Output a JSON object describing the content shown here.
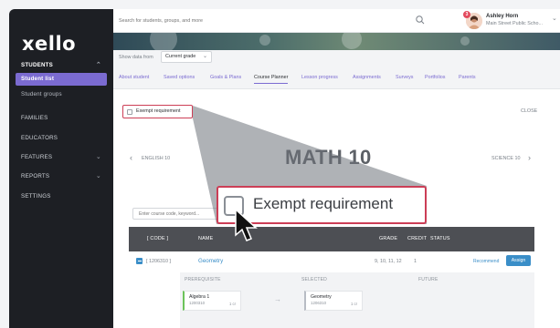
{
  "sidebar": {
    "logo": "xello",
    "items": [
      {
        "label": "STUDENTS"
      },
      {
        "label": "Student list"
      },
      {
        "label": "Student groups"
      },
      {
        "label": "FAMILIES"
      },
      {
        "label": "EDUCATORS"
      },
      {
        "label": "FEATURES"
      },
      {
        "label": "REPORTS"
      },
      {
        "label": "SETTINGS"
      }
    ]
  },
  "topbar": {
    "search_placeholder": "Search for students, groups, and more",
    "user_name": "Ashley Horn",
    "user_school": "Main Street Public Scho...",
    "notification_count": "3"
  },
  "filter": {
    "label": "Show data from",
    "value": "Current grade"
  },
  "tabs": [
    {
      "label": "About student"
    },
    {
      "label": "Saved options"
    },
    {
      "label": "Goals & Plans"
    },
    {
      "label": "Course Planner"
    },
    {
      "label": "Lesson progress"
    },
    {
      "label": "Assignments"
    },
    {
      "label": "Surveys"
    },
    {
      "label": "Portfolios"
    },
    {
      "label": "Parents"
    }
  ],
  "active_tab": "Course Planner",
  "planner": {
    "exempt_label": "Exempt requirement",
    "close_label": "CLOSE",
    "prev_course": "ENGLISH 10",
    "title": "MATH 10",
    "next_course": "SCIENCE 10",
    "code_placeholder": "Enter course code, keyword...",
    "table": {
      "headers": {
        "code": "[ CODE ]",
        "name": "NAME",
        "grade": "GRADE",
        "credit": "CREDIT",
        "status": "STATUS"
      },
      "row": {
        "code": "[ 1206310 ]",
        "name": "Geometry",
        "grade": "9, 10, 11, 12",
        "credit": "1",
        "recommend": "Recommend",
        "assign": "Assign"
      }
    },
    "prereq": {
      "headers": {
        "prerequisite": "PREREQUISITE",
        "selected": "SELECTED",
        "future": "FUTURE"
      },
      "prerequisite_card": {
        "name": "Algebra 1",
        "code": "1200310",
        "credit": "1 cr"
      },
      "selected_card": {
        "name": "Geometry",
        "code": "1206310",
        "credit": "1 cr"
      }
    }
  },
  "zoom": {
    "label": "Exempt requirement"
  },
  "colors": {
    "accent": "#7b6bd1",
    "link": "#3a8ec8",
    "highlight": "#cc3e56",
    "sidebar": "#1d1f24"
  }
}
